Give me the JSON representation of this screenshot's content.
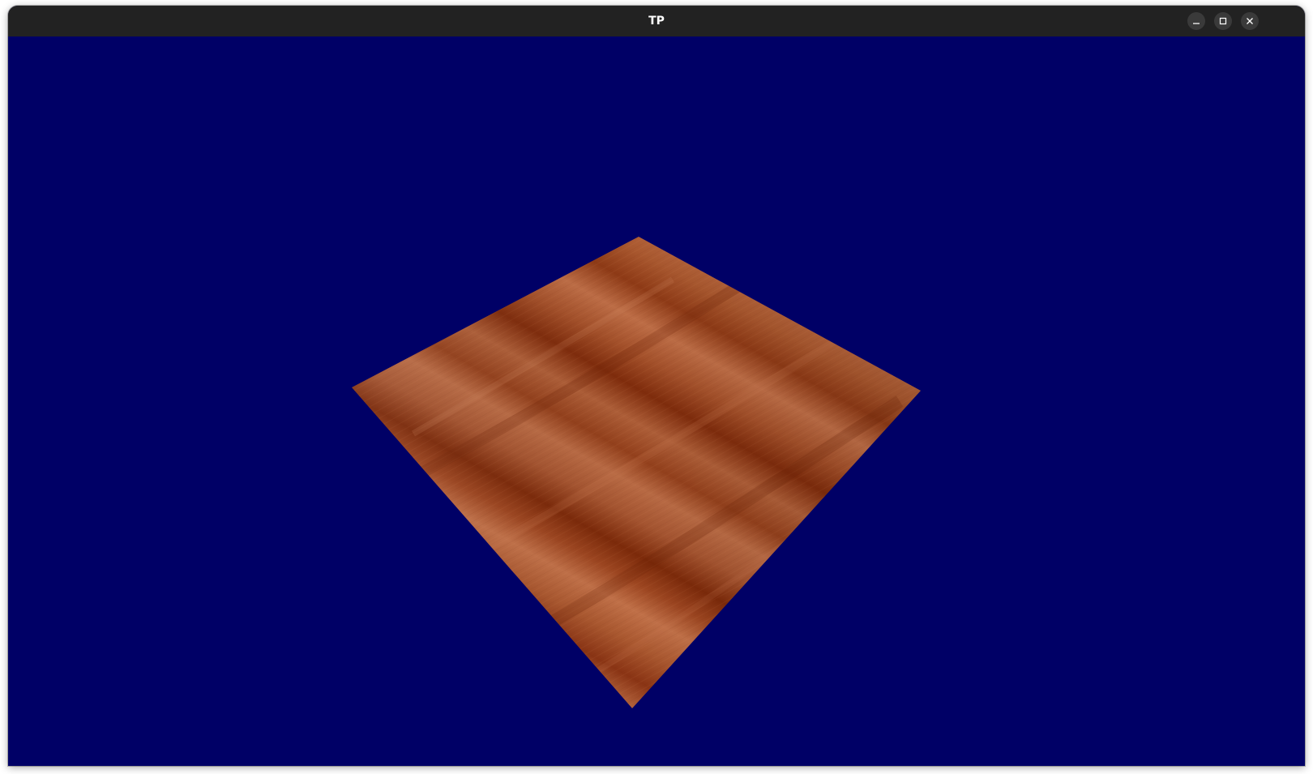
{
  "window": {
    "title": "TP",
    "controls": [
      {
        "name": "minimize-button",
        "icon": "minimize-icon"
      },
      {
        "name": "maximize-button",
        "icon": "maximize-icon"
      },
      {
        "name": "close-button",
        "icon": "close-icon"
      }
    ]
  },
  "scene": {
    "background_color": "#000066",
    "object": "wood-textured-plane",
    "wood_colors": {
      "light": "#b5673e",
      "mid": "#9c4a25",
      "dark": "#7a2a0c"
    }
  }
}
